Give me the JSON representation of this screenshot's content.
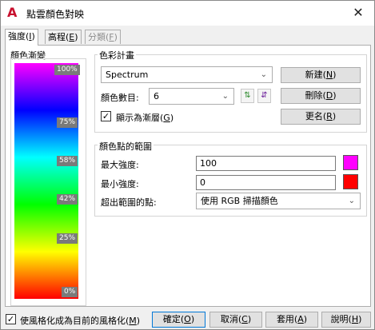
{
  "window": {
    "title": "點雲顏色對映",
    "close_glyph": "✕"
  },
  "tabs": [
    {
      "label": "強度(",
      "key": "I",
      "suffix": ")"
    },
    {
      "label": "高程(",
      "key": "E",
      "suffix": ")"
    },
    {
      "label": "分類(",
      "key": "F",
      "suffix": ")"
    }
  ],
  "gradient_panel": {
    "label": "顏色漸變",
    "ticks": [
      "100%",
      "75%",
      "58%",
      "42%",
      "25%",
      "0%"
    ]
  },
  "scheme": {
    "title": "色彩計畫",
    "selected": "Spectrum",
    "count_label": "顏色數目:",
    "count_value": "6",
    "show_gradient_label": "顯示為漸層(",
    "show_gradient_key": "G",
    "show_gradient_checked": true,
    "buttons": {
      "new": {
        "label": "新建(",
        "key": "N"
      },
      "delete": {
        "label": "刪除(",
        "key": "D"
      },
      "rename": {
        "label": "更名(",
        "key": "R"
      }
    }
  },
  "range": {
    "title": "顏色點的範圍",
    "max_label": "最大強度:",
    "max_value": "100",
    "min_label": "最小強度:",
    "min_value": "0",
    "out_label": "超出範圍的點:",
    "out_value": "使用 RGB 掃描顏色",
    "max_color": "#ff00ff",
    "min_color": "#ff0000"
  },
  "footer": {
    "style_check_label": "使風格化成為目前的風格化(",
    "style_check_key": "M",
    "style_checked": true,
    "ok": {
      "label": "確定(",
      "key": "O"
    },
    "cancel": {
      "label": "取消(",
      "key": "C"
    },
    "apply": {
      "label": "套用(",
      "key": "A"
    },
    "help": {
      "label": "說明(",
      "key": "H"
    }
  }
}
